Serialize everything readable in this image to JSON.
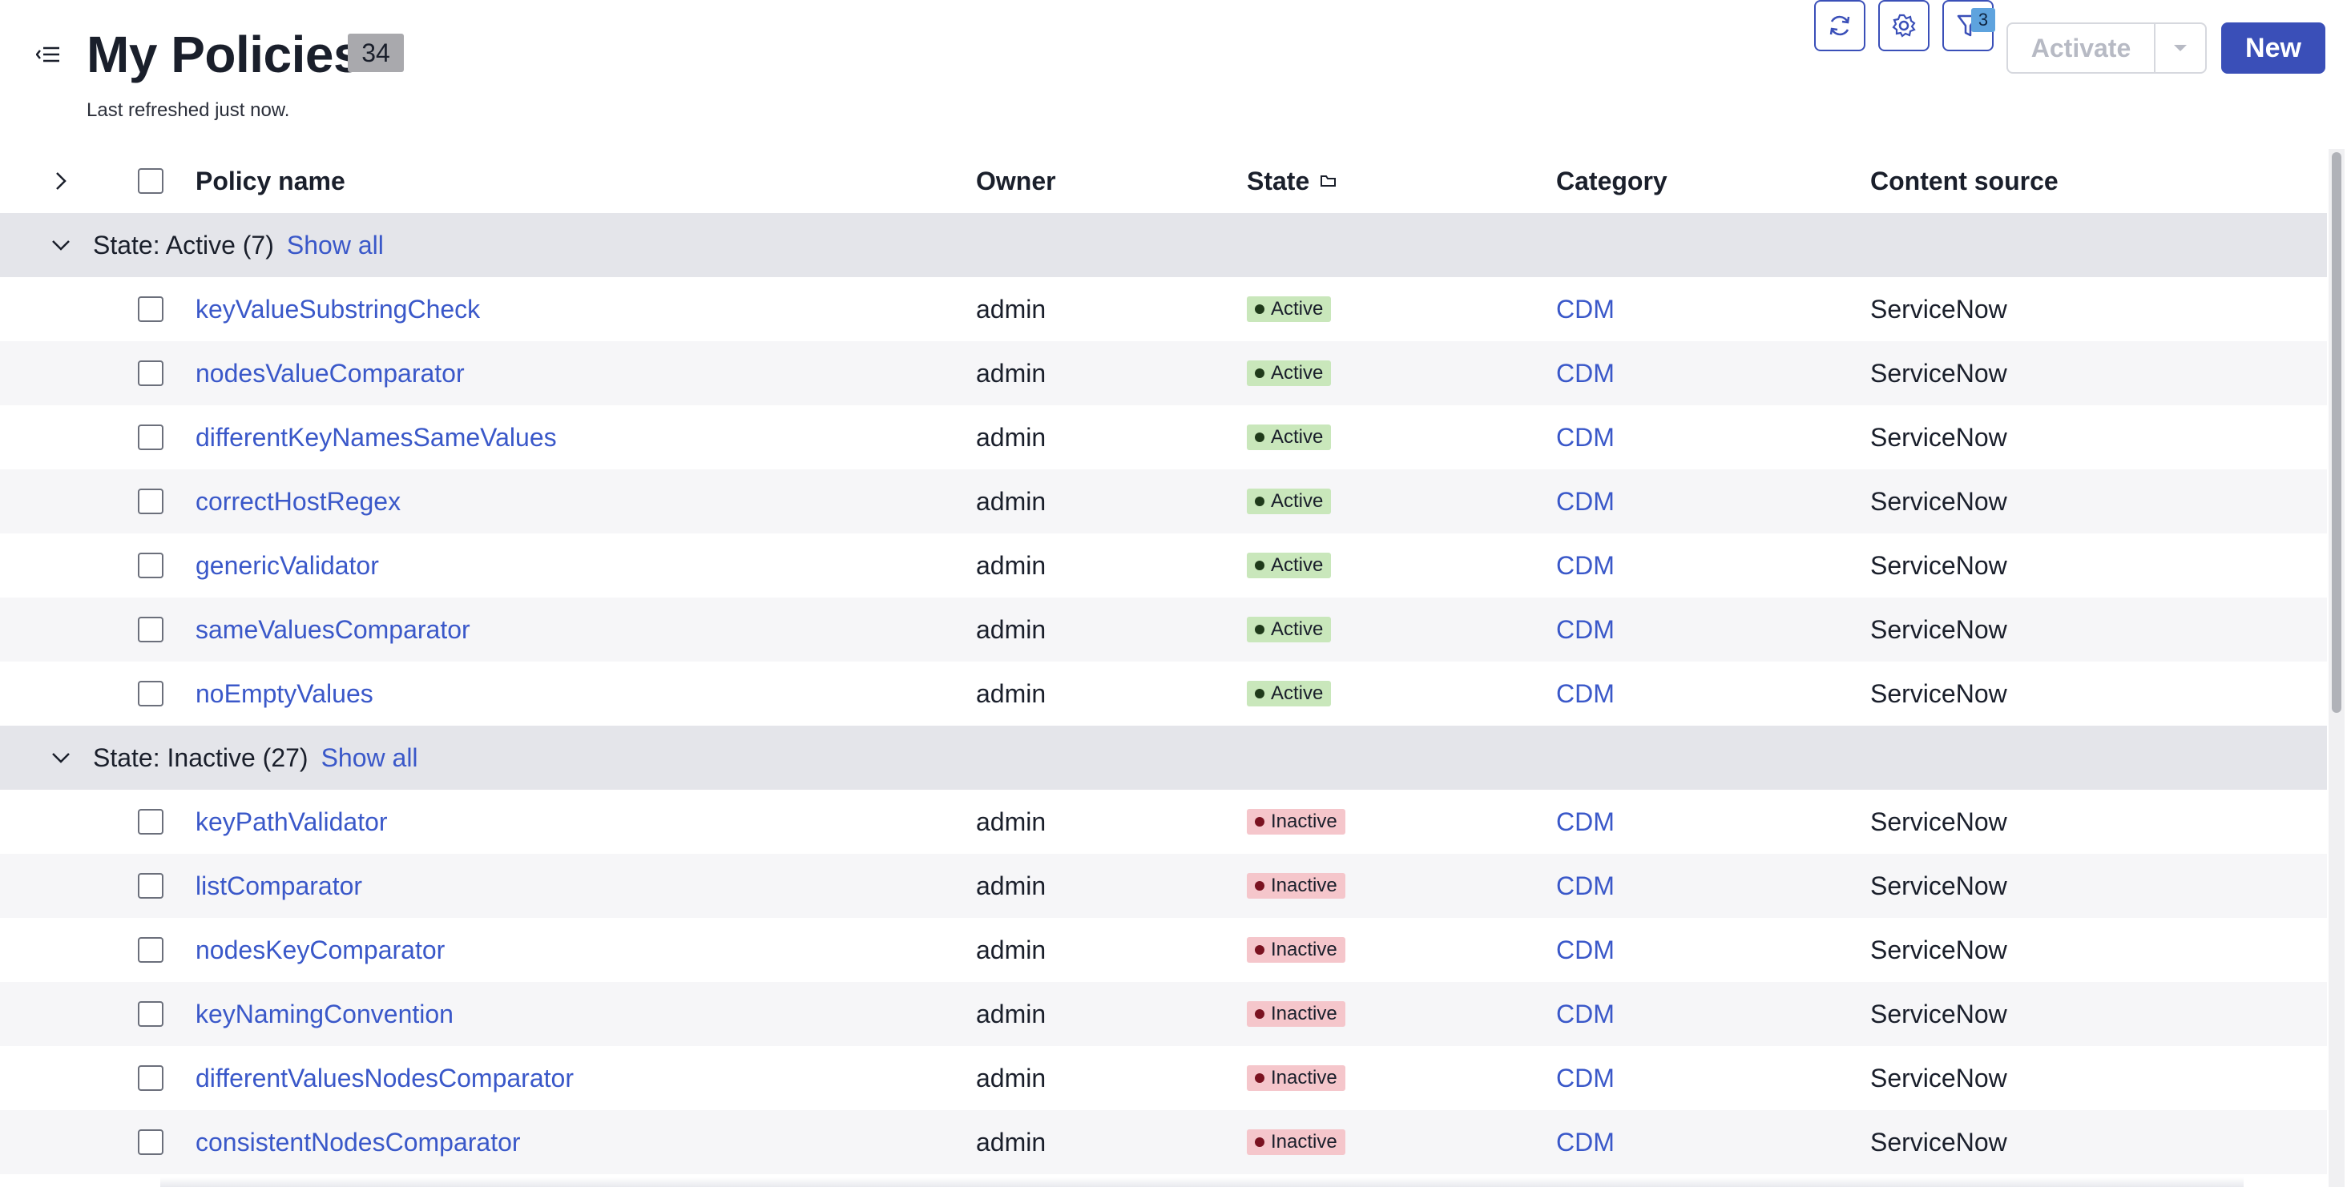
{
  "header": {
    "title": "My Policies",
    "count": "34",
    "refreshed": "Last refreshed just now.",
    "filter_count": "3",
    "activate_label": "Activate",
    "new_label": "New"
  },
  "table": {
    "columns": {
      "name": "Policy name",
      "owner": "Owner",
      "state": "State",
      "category": "Category",
      "source": "Content source"
    },
    "groups": [
      {
        "label": "State: Active (7)",
        "show_all": "Show all"
      },
      {
        "label": "State: Inactive (27)",
        "show_all": "Show all"
      }
    ],
    "active_rows": [
      {
        "name": "keyValueSubstringCheck",
        "owner": "admin",
        "state": "Active",
        "category": "CDM",
        "source": "ServiceNow"
      },
      {
        "name": "nodesValueComparator",
        "owner": "admin",
        "state": "Active",
        "category": "CDM",
        "source": "ServiceNow"
      },
      {
        "name": "differentKeyNamesSameValues",
        "owner": "admin",
        "state": "Active",
        "category": "CDM",
        "source": "ServiceNow"
      },
      {
        "name": "correctHostRegex",
        "owner": "admin",
        "state": "Active",
        "category": "CDM",
        "source": "ServiceNow"
      },
      {
        "name": "genericValidator",
        "owner": "admin",
        "state": "Active",
        "category": "CDM",
        "source": "ServiceNow"
      },
      {
        "name": "sameValuesComparator",
        "owner": "admin",
        "state": "Active",
        "category": "CDM",
        "source": "ServiceNow"
      },
      {
        "name": "noEmptyValues",
        "owner": "admin",
        "state": "Active",
        "category": "CDM",
        "source": "ServiceNow"
      }
    ],
    "inactive_rows": [
      {
        "name": "keyPathValidator",
        "owner": "admin",
        "state": "Inactive",
        "category": "CDM",
        "source": "ServiceNow"
      },
      {
        "name": "listComparator",
        "owner": "admin",
        "state": "Inactive",
        "category": "CDM",
        "source": "ServiceNow"
      },
      {
        "name": "nodesKeyComparator",
        "owner": "admin",
        "state": "Inactive",
        "category": "CDM",
        "source": "ServiceNow"
      },
      {
        "name": "keyNamingConvention",
        "owner": "admin",
        "state": "Inactive",
        "category": "CDM",
        "source": "ServiceNow"
      },
      {
        "name": "differentValuesNodesComparator",
        "owner": "admin",
        "state": "Inactive",
        "category": "CDM",
        "source": "ServiceNow"
      },
      {
        "name": "consistentNodesComparator",
        "owner": "admin",
        "state": "Inactive",
        "category": "CDM",
        "source": "ServiceNow"
      }
    ]
  },
  "colors": {
    "primary": "#3a4fb8",
    "link": "#3a58c9",
    "active_badge": "#c9e7bb",
    "inactive_badge": "#f5c6cb",
    "group_row": "#e4e5ea"
  },
  "icons": {
    "collapse": "sidebar-collapse-icon",
    "refresh": "refresh-icon",
    "settings": "gear-icon",
    "filter": "filter-icon",
    "dropdown": "caret-down-icon",
    "expand": "chevron-right-icon",
    "group_toggle": "chevron-down-icon",
    "sort": "folder-icon"
  }
}
